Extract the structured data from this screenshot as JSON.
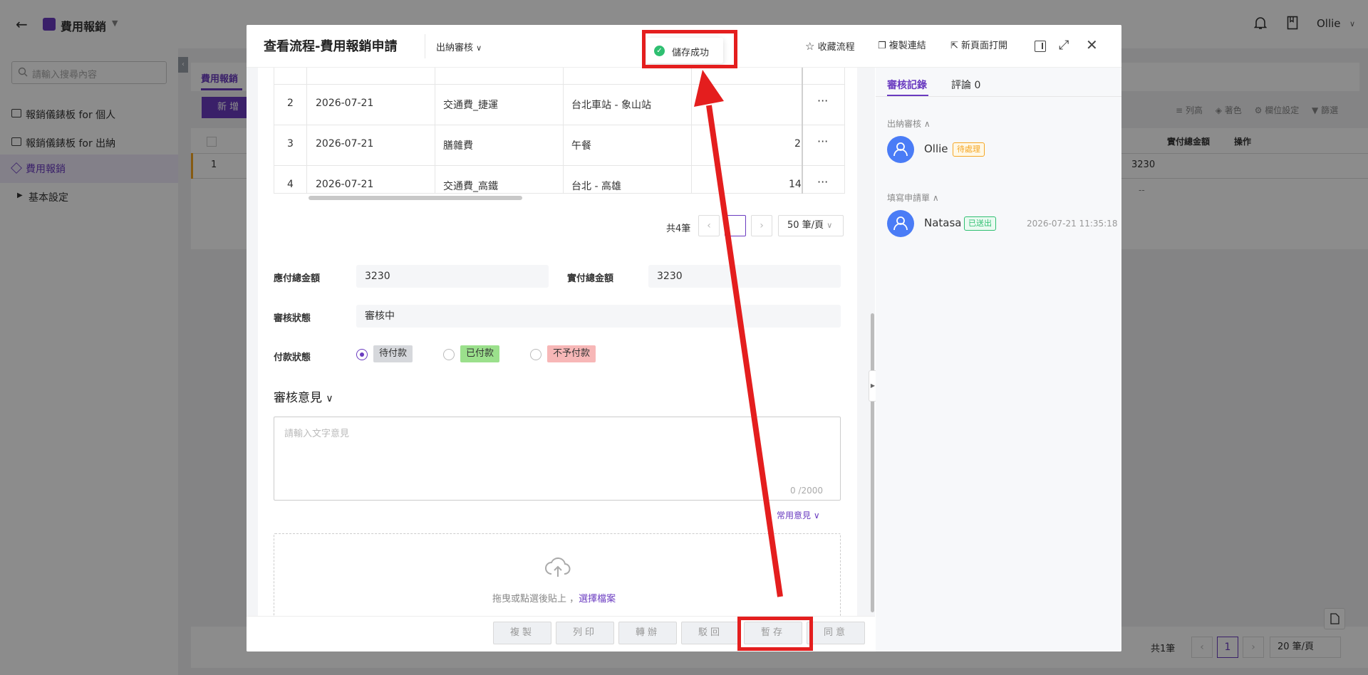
{
  "app": {
    "title": "費用報銷",
    "user": "Ollie",
    "search_placeholder": "請輸入搜尋內容",
    "nav": [
      {
        "label": "報銷儀錶板 for 個人"
      },
      {
        "label": "報銷儀錶板 for 出納"
      },
      {
        "label": "費用報銷"
      },
      {
        "label": "基本設定"
      }
    ],
    "tab": "費用報銷",
    "add_button": "新 增",
    "toolbar": {
      "columns": "列高",
      "color": "著色",
      "fields": "欄位設定",
      "filter": "篩選"
    },
    "table": {
      "col_total": "實付總金額",
      "col_action": "操作",
      "row_no": "1",
      "row_value": "3230",
      "filter_placeholder": "--"
    },
    "pagination": {
      "total": "共1筆",
      "page": "1",
      "size": "20 筆/頁"
    }
  },
  "modal": {
    "title": "查看流程-費用報銷申請",
    "stage": "出納審核",
    "toast": "儲存成功",
    "actions": {
      "favorite": "收藏流程",
      "copy_link": "複製連結",
      "open_new": "新頁面打開"
    },
    "rows": [
      {
        "no": "2",
        "date": "2026-07-21",
        "type": "交通費_捷運",
        "desc": "台北車站 - 象山站",
        "amount": ""
      },
      {
        "no": "3",
        "date": "2026-07-21",
        "type": "膳雜費",
        "desc": "午餐",
        "amount": "2"
      },
      {
        "no": "4",
        "date": "2026-07-21",
        "type": "交通費_高鐵",
        "desc": "台北 - 高雄",
        "amount": "14"
      }
    ],
    "row_menu": "···",
    "pagination": {
      "total": "共4筆",
      "size": "50 筆/頁"
    },
    "form": {
      "payable_label": "應付總金額",
      "payable_value": "3230",
      "paid_label": "實付總金額",
      "paid_value": "3230",
      "status_label": "審核狀態",
      "status_value": "審核中",
      "payment_label": "付款狀態",
      "payment_options": [
        "待付款",
        "已付款",
        "不予付款"
      ]
    },
    "opinion": {
      "title": "審核意見",
      "placeholder": "請輸入文字意見",
      "counter": "0 /2000",
      "common": "常用意見"
    },
    "upload": {
      "text": "拖曳或點選後貼上 ，",
      "link": "選擇檔案"
    },
    "buttons": {
      "copy": "複製",
      "print": "列印",
      "transfer": "轉辦",
      "reject": "駁回",
      "save": "暫存",
      "approve": "同意"
    },
    "side": {
      "tab_records": "審核記錄",
      "tab_comments": "評論 0",
      "step1": "出納審核",
      "step1_user": "Ollie",
      "step1_badge": "待處理",
      "step2": "填寫申請單",
      "step2_user": "Natasa",
      "step2_badge": "已送出",
      "step2_time": "2026-07-21 11:35:18"
    }
  },
  "colors": {
    "accent": "#6a3bc0",
    "annotation": "#e41e1e",
    "success": "#2fbf71",
    "pending": "#f5a623",
    "avatar": "#4a7cf6"
  }
}
